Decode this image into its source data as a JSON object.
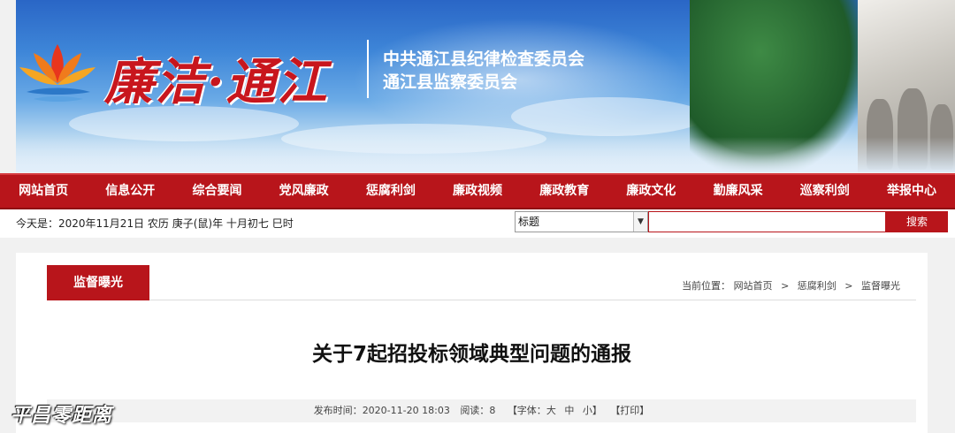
{
  "header": {
    "logo_text": "廉洁·通江",
    "org_line1": "中共通江县纪律检查委员会",
    "org_line2": "通江县监察委员会"
  },
  "nav": {
    "items": [
      {
        "label": "网站首页"
      },
      {
        "label": "信息公开"
      },
      {
        "label": "综合要闻"
      },
      {
        "label": "党风廉政"
      },
      {
        "label": "惩腐利剑"
      },
      {
        "label": "廉政视频"
      },
      {
        "label": "廉政教育"
      },
      {
        "label": "廉政文化"
      },
      {
        "label": "勤廉风采"
      },
      {
        "label": "巡察利剑"
      },
      {
        "label": "举报中心"
      }
    ]
  },
  "datebar": {
    "today": "今天是：2020年11月21日 农历 庚子(鼠)年 十月初七 巳时"
  },
  "search": {
    "selected_option": "标题",
    "button_label": "搜索"
  },
  "column": {
    "title": "监督曝光"
  },
  "breadcrumb": {
    "prefix": "当前位置：",
    "items": [
      "网站首页",
      "惩腐利剑",
      "监督曝光"
    ],
    "sep": ">"
  },
  "article": {
    "title": "关于7起招投标领域典型问题的通报",
    "publish_label": "发布时间：",
    "publish_time": "2020-11-20 18:03",
    "reads_label": "阅读：",
    "reads": "8",
    "font_open": "【字体：",
    "font_large": "大",
    "font_medium": "中",
    "font_small": "小",
    "font_close": "】",
    "print": "【打印】"
  },
  "watermark": "平昌零距离",
  "colors": {
    "primary_red": "#b8151b",
    "banner_blue": "#3e86d8"
  }
}
